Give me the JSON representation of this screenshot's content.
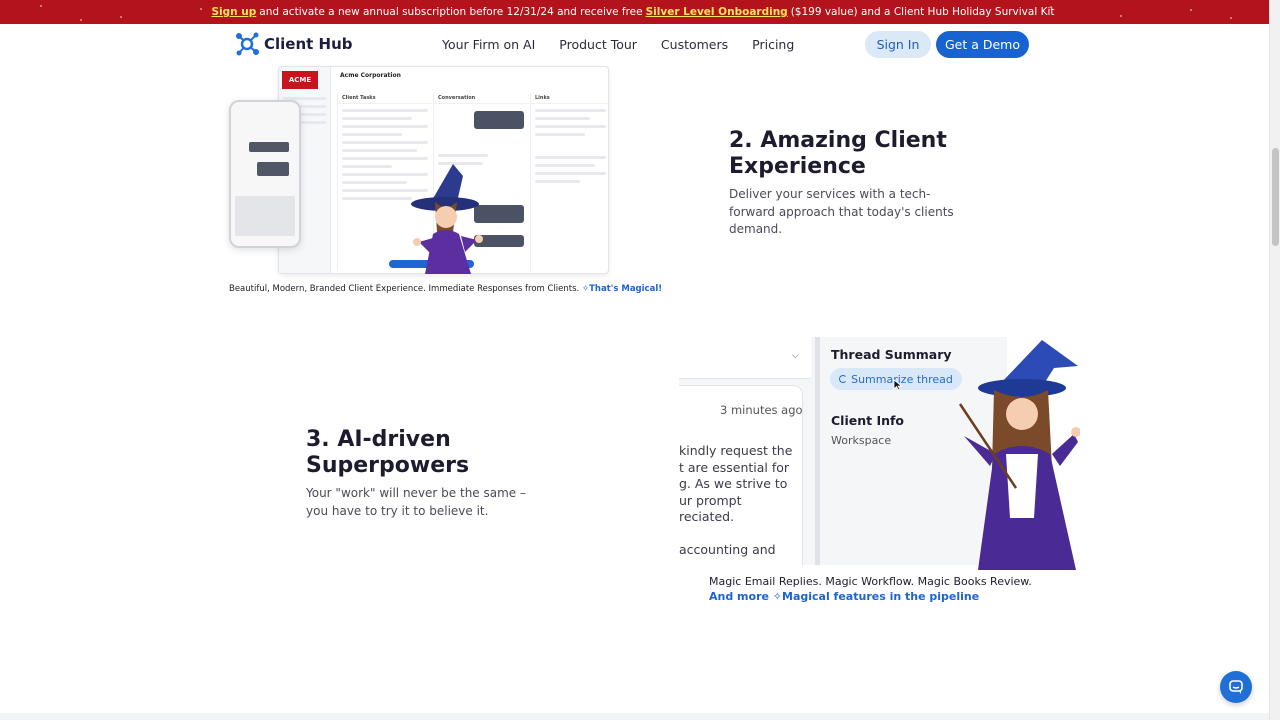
{
  "promo": {
    "signup_link": "Sign up",
    "text_1": "and activate a new annual subscription before 12/31/24 and receive free",
    "offer_link": "Silver Level Onboarding",
    "text_2": "($199 value) and a Client Hub Holiday Survival Kit"
  },
  "nav": {
    "logo_text": "Client Hub",
    "links": [
      "Your Firm on AI",
      "Product Tour",
      "Customers",
      "Pricing"
    ],
    "signin_label": "Sign In",
    "demo_label": "Get a Demo"
  },
  "section2": {
    "title": "2. Amazing Client Experience",
    "description": "Deliver your services with a tech-forward approach that today's clients demand.",
    "caption_main": "Beautiful, Modern, Branded Client Experience. Immediate Responses from Clients.",
    "caption_magic": "✧That's Magical!",
    "mockup": {
      "logo": "ACME",
      "company": "Acme Corporation",
      "col_tasks": "Client Tasks",
      "col_conversation": "Conversation",
      "col_links": "Links"
    }
  },
  "section3": {
    "title": "3. AI-driven Superpowers",
    "description": "Your \"work\" will never be the same – you have to try it to believe it.",
    "caption_line1": "Magic Email Replies. Magic Workflow. Magic Books Review.",
    "caption_line2": "And more ✧Magical features in the pipeline",
    "mockup": {
      "time": "3 minutes ago",
      "email_lines": [
        "kindly request the",
        "t are essential for",
        "g. As we strive to",
        "ur prompt",
        "reciated."
      ],
      "email_line_last": "accounting and",
      "thread_summary_title": "Thread Summary",
      "summarize_button": "Summarize thread",
      "client_info_title": "Client Info",
      "workspace_label": "Workspace"
    }
  },
  "colors": {
    "promo_bg": "#b3141c",
    "promo_link": "#ffe45c",
    "primary": "#1763d1",
    "signin_bg": "#dbe9f7"
  },
  "icons": {
    "logo": "network-hub-icon",
    "chat": "chat-bubble-icon",
    "spinner": "loading-spinner-icon",
    "cursor": "mouse-pointer-icon"
  }
}
